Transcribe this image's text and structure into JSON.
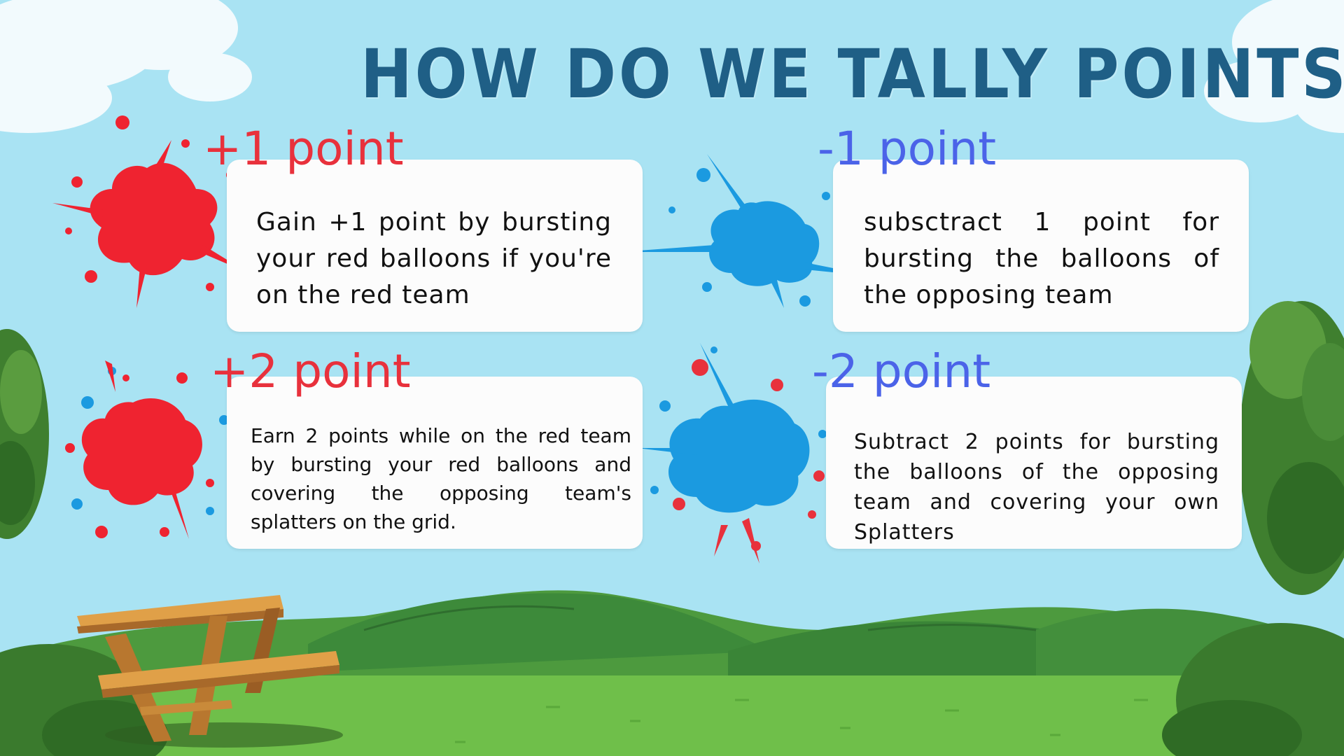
{
  "title": "HOW DO WE TALLY POINTS?",
  "colors": {
    "sky": "#a9e3f3",
    "title": "#1f5f86",
    "red_splat": "#ef2330",
    "blue_splat": "#1b9ae0",
    "red_label": "#e8313c",
    "blue_label": "#4b63e8",
    "card": "#fcfcfc",
    "grass": "#6fbf4a",
    "hill": "#3d8a3a"
  },
  "rules": [
    {
      "label": "+1 point",
      "text": "Gain +1 point by bursting your red balloons if you're on the red team",
      "icon": "red-splat-icon"
    },
    {
      "label": "-1 point",
      "text": "subsctract 1 point for bursting the balloons of the opposing team",
      "icon": "blue-splat-icon"
    },
    {
      "label": "+2 point",
      "text": "Earn 2 points while on the red team by bursting your red balloons and covering the opposing team's splatters on the grid.",
      "icon": "red-splat-icon"
    },
    {
      "label": "-2 point",
      "text": "Subtract 2 points for bursting the balloons of the opposing team and covering your own Splatters",
      "icon": "blue-splat-icon"
    }
  ],
  "decorations": [
    "cloud-icon",
    "hills-icon",
    "tree-icon",
    "bush-icon",
    "picnic-table-icon"
  ]
}
